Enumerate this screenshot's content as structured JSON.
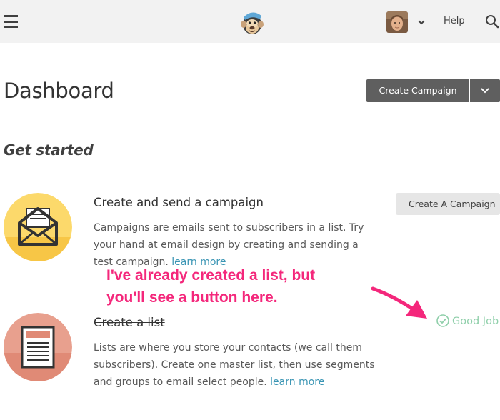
{
  "topbar": {
    "help_label": "Help"
  },
  "page": {
    "title": "Dashboard",
    "create_campaign_label": "Create Campaign"
  },
  "get_started": {
    "title": "Get started",
    "items": [
      {
        "title": "Create and send a campaign",
        "description": "Campaigns are emails sent to subscribers in a list. Try your hand at email design by creating and sending a test campaign.",
        "learn_more": "learn more",
        "action_label": "Create A Campaign",
        "icon": "envelope-icon",
        "badge_color": "#fcd96b"
      },
      {
        "title": "Create a list",
        "completed": true,
        "description": "Lists are where you store your contacts (we call them subscribers). Create one master list, then use segments and groups to email select people.",
        "learn_more": "learn more",
        "status_label": "Good Job",
        "icon": "list-document-icon",
        "badge_color": "#e8a08e"
      }
    ]
  },
  "annotation": {
    "line1": "I've already created a list, but",
    "line2": "you'll see a button here.",
    "color": "#f4277b"
  }
}
